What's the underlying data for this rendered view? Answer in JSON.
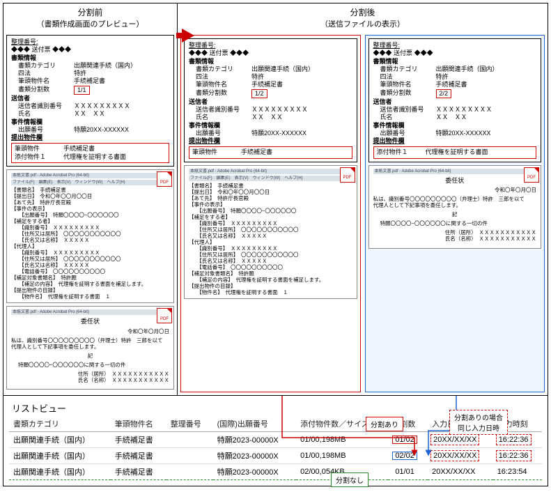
{
  "headers": {
    "before_title": "分割前",
    "before_sub": "（書類作成画面のプレビュー）",
    "after_title": "分割後",
    "after_sub": "（送信ファイルの表示）"
  },
  "sheet_labels": {
    "serial_label": "整理番号:",
    "cover_marker_left": "◆◆◆",
    "cover_text": "送付票",
    "cover_marker_right": "◆◆◆",
    "docinfo": "書類情報",
    "category_k": "書類カテゴリ",
    "category_v": "出願関連手続（国内）",
    "four_laws_k": "四法",
    "four_laws_v": "特許",
    "head_bukken_k": "筆頭物件名",
    "head_bukken_v": "手続補足書",
    "split_count_k": "書類分割数",
    "sender": "送信者",
    "sender_id_k": "送信者識別番号",
    "sender_id_v": "ＸＸＸＸＸＸＸＸＸ",
    "name_k": "氏名",
    "name_v": "ＸＸ　ＸＸ",
    "case_info": "事件情報欄",
    "app_no_k": "出願番号",
    "app_no_v": "特願20XX-XXXXXX",
    "submitted_items": "提出物件欄",
    "item_head_k": "筆頭物件",
    "item_head_v": "手続補足書",
    "item_attach_k": "添付物件１",
    "item_attach_v": "代理権を証明する書面"
  },
  "split_vals": {
    "before": "1/1",
    "after1": "1/2",
    "after2": "2/2"
  },
  "pdf1": {
    "toolbar": "本紙文書.pdf - Adobe Acrobat Pro (64-bit)",
    "toolbar_menu": "ファイル(F)　編集(E)　表示(V)　ウィンドウ(W)　ヘルプ(H)",
    "lines": [
      "【書類名】　手続補足書",
      "【提出日】　令和〇年〇〇月〇〇日",
      "【あて先】　特許庁長官殿",
      "【事件の表示】",
      "　　【出願番号】　特願〇〇〇〇−〇〇〇〇〇〇",
      "【補足をする者】",
      "　　【識別番号】　ＸＸＸＸＸＸＸＸＸ",
      "　　【住所又は居所】　〇〇〇〇〇〇〇〇〇〇〇",
      "　　【氏名又は名称】　ＸＸＸＸＸ",
      "【代理人】",
      "　　【識別番号】　ＸＸＸＸＸＸＸＸＸ",
      "　　【住所又は居所】　〇〇〇〇〇〇〇〇〇〇〇",
      "　　【氏名又は名称】　ＸＸＸＸＸ",
      "　　【電話番号】　〇〇〇〇〇〇〇〇〇〇",
      "【補足対象書類名】　特許願",
      "　　【補足の内容】　代理権を証明する書面を補足します。",
      "【提出物件の目録】",
      "　　【物件名】　代理権を証明する書面　１"
    ]
  },
  "pdf2": {
    "title": "委任状",
    "date": "令和〇年〇月〇日",
    "body_line": "私は、識別番号〇〇〇〇〇〇〇〇〇（弁理士）特許　三郎を以て",
    "body_line2": "代理人として下記事項を委任します。",
    "ki": "記",
    "matter": "特願〇〇〇〇−〇〇〇〇〇〇に関する一切の件",
    "addr_k": "住所（居所）",
    "addr_v": "ＸＸＸＸＸＸＸＸＸＸＸ",
    "name_k": "氏名（名称）",
    "name_v": "ＸＸＸＸＸＸＸＸＸＸＸ"
  },
  "callouts": {
    "split_yes": "分割あり",
    "split_same_datetime": "分割ありの場合\n同じ入力日時",
    "split_no": "分割なし"
  },
  "listview": {
    "title": "リストビュー",
    "headers": {
      "category": "書類カテゴリ",
      "head_item": "筆頭物件名",
      "serial": "整理番号",
      "intl_app": "(国際)出願番号",
      "attach_count": "添付物件数／サイズ",
      "split": "分割数",
      "input_date": "入力日",
      "input_time": "入力時刻"
    },
    "rows": [
      {
        "category": "出願関連手続（国内）",
        "head": "手続補足書",
        "serial": "",
        "app": "特願2023-00000X",
        "attach": "01/00,198MB",
        "split": "01/02",
        "date": "20XX/XX/XX",
        "time": "16:22:36"
      },
      {
        "category": "出願関連手続（国内）",
        "head": "手続補足書",
        "serial": "",
        "app": "特願2023-00000X",
        "attach": "01/00,198MB",
        "split": "02/02",
        "date": "20XX/XX/XX",
        "time": "16:22:36"
      },
      {
        "category": "出願関連手続（国内）",
        "head": "手続補足書",
        "serial": "",
        "app": "特願2023-00000X",
        "attach": "02/00,054KB",
        "split": "01/01",
        "date": "20XX/XX/XX",
        "time": "16:23:54"
      }
    ]
  },
  "pdf_badge": "PDF"
}
